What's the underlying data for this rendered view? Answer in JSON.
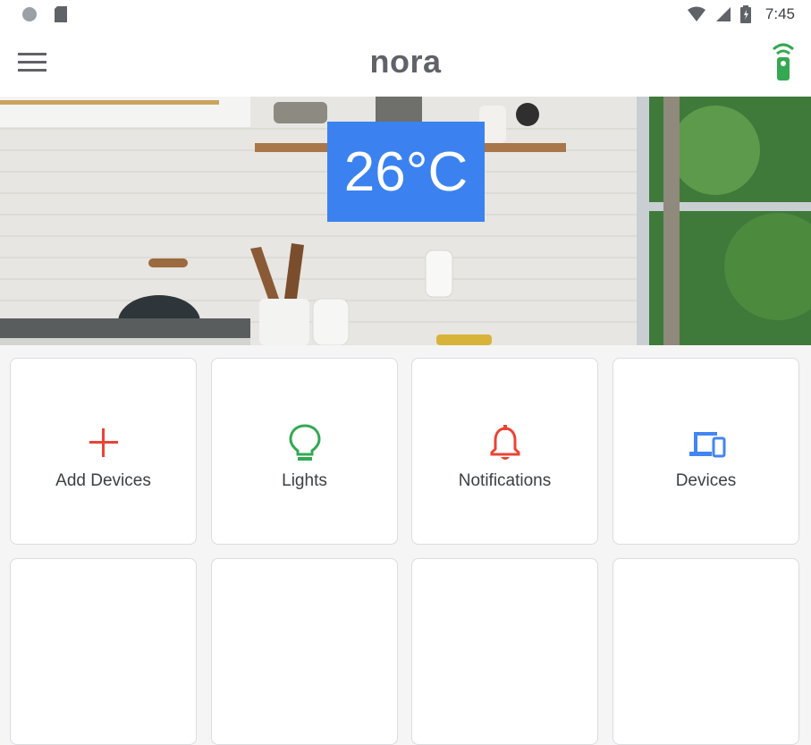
{
  "status_bar": {
    "time": "7:45",
    "icons": [
      "circle-icon",
      "sd-card-icon",
      "wifi-icon",
      "signal-icon",
      "battery-icon"
    ]
  },
  "app_bar": {
    "title": "nora",
    "menu_icon": "menu-icon",
    "remote_icon": "remote-icon",
    "remote_color": "#34a853"
  },
  "hero": {
    "temperature": "26°C",
    "badge_color": "#3b82f0"
  },
  "tiles": [
    {
      "label": "Add Devices",
      "icon": "plus-icon",
      "color": "#ea4335"
    },
    {
      "label": "Lights",
      "icon": "lightbulb-icon",
      "color": "#34a853"
    },
    {
      "label": "Notifications",
      "icon": "bell-icon",
      "color": "#ea4335"
    },
    {
      "label": "Devices",
      "icon": "devices-icon",
      "color": "#4285f4"
    }
  ]
}
